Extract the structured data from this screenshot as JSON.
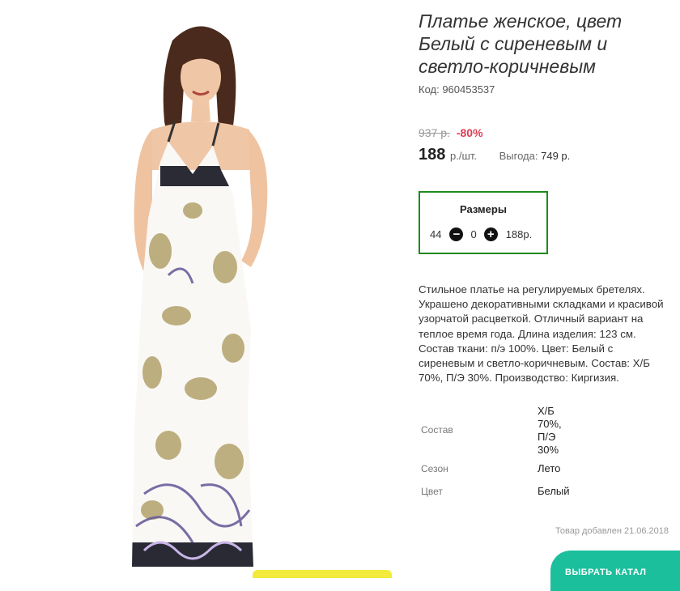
{
  "product": {
    "title_lines": [
      "Платье женское, цвет",
      "Белый с сиреневым и",
      "светло-коричневым"
    ],
    "code": "Код: 960453537",
    "old_price": "937 р.",
    "discount": "-80%",
    "price": "188",
    "price_unit": "р./шт.",
    "savings_label": "Выгода:",
    "savings_value": "749 р."
  },
  "sizes": {
    "title": "Размеры",
    "size": "44",
    "minus_icon": "minus-circle-icon",
    "quantity": "0",
    "plus_icon": "plus-circle-icon",
    "price": "188р."
  },
  "description_lines": [
    "Стильное платье на регулируемых бретелях.",
    "Украшено декоративными складками и красивой",
    "узорчатой расцветкой. Отличный вариант на",
    "теплое время года. Длина изделия: 123 см.",
    "Состав ткани: п/э 100%. Цвет: Белый с",
    "сиреневым и светло-коричневым. Состав: Х/Б",
    "70%, П/Э 30%. Производство: Киргизия."
  ],
  "properties": [
    {
      "label": "Состав",
      "value_lines": [
        "Х/Б",
        "70%,",
        "П/Э",
        "30%"
      ]
    },
    {
      "label": "Сезон",
      "value_lines": [
        "Лето"
      ]
    },
    {
      "label": "Цвет",
      "value_lines": [
        "Белый"
      ]
    }
  ],
  "added": "Товар добавлен 21.06.2018",
  "colors": {
    "sizes_border": "#1e8a1e",
    "discount": "#e03b52",
    "bottom_button": "#1bbf9c",
    "bottom_bar": "#f2eb3b"
  },
  "bottom_button_label": "ВЫБРАТЬ КАТАЛ"
}
